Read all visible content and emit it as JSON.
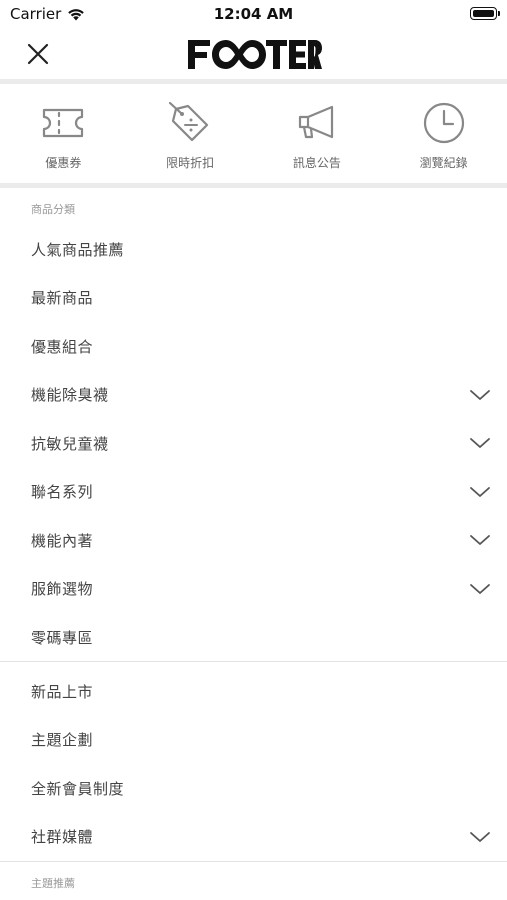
{
  "status_bar": {
    "carrier": "Carrier",
    "time": "12:04 AM"
  },
  "header": {
    "logo_text": "FOOTER"
  },
  "shortcuts": [
    {
      "label": "優惠券",
      "icon": "ticket-icon"
    },
    {
      "label": "限時折扣",
      "icon": "discount-tag-icon"
    },
    {
      "label": "訊息公告",
      "icon": "megaphone-icon"
    },
    {
      "label": "瀏覽紀錄",
      "icon": "clock-icon"
    }
  ],
  "category_section": {
    "title": "商品分類",
    "items": [
      {
        "label": "人氣商品推薦",
        "expandable": false
      },
      {
        "label": "最新商品",
        "expandable": false
      },
      {
        "label": "優惠組合",
        "expandable": false
      },
      {
        "label": "機能除臭襪",
        "expandable": true
      },
      {
        "label": "抗敏兒童襪",
        "expandable": true
      },
      {
        "label": "聯名系列",
        "expandable": true
      },
      {
        "label": "機能內著",
        "expandable": true
      },
      {
        "label": "服飾選物",
        "expandable": true
      },
      {
        "label": "零碼專區",
        "expandable": false
      }
    ]
  },
  "info_section": {
    "items": [
      {
        "label": "新品上市",
        "expandable": false
      },
      {
        "label": "主題企劃",
        "expandable": false
      },
      {
        "label": "全新會員制度",
        "expandable": false
      },
      {
        "label": "社群媒體",
        "expandable": true
      }
    ]
  },
  "theme_section": {
    "title": "主題推薦"
  },
  "colors": {
    "divider_thick": "#ebebeb",
    "divider_thin": "#e4e4e4",
    "text_primary": "#444444",
    "text_secondary": "#999999",
    "icon_gray": "#888888"
  }
}
